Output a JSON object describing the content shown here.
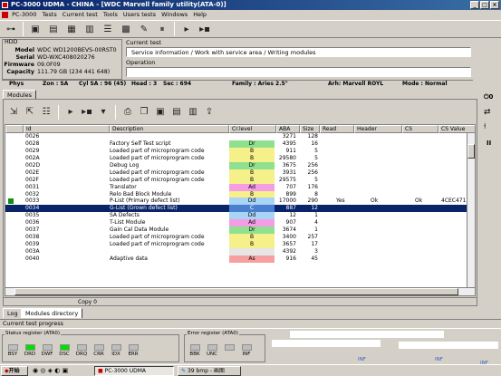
{
  "window": {
    "title": "PC-3000 UDMA - CHINA - [WDC Marvell family utility(ATA-0)]"
  },
  "menu": [
    "PC-3000",
    "Tests",
    "Current test",
    "Tools",
    "Users tests",
    "Windows",
    "Help"
  ],
  "hdd": {
    "section_label": "HDD",
    "model_label": "Model",
    "model": "WDC WD1200BEVS-00RST0",
    "serial_label": "Serial",
    "serial": "WD-WXC408020276",
    "firmware_label": "Firmware",
    "firmware": "09.0F09",
    "capacity_label": "Capacity",
    "capacity": "111.79 GB (234 441 648)"
  },
  "current_test": {
    "label": "Current test",
    "value": "Service information / Work with service area / Writing modules",
    "operation_label": "Operation",
    "operation": ""
  },
  "info": {
    "phys": "Phys",
    "zone": "Zon : SA",
    "cyl": "Cyl SA : 96 (45)",
    "head": "Head : 3",
    "sec": "Sec : 694",
    "family": "Family : Aries 2.5\"",
    "arh": "Arh: Marvell ROYL",
    "mode": "Mode : Normal"
  },
  "top_tab": "Modules",
  "grid": {
    "headers": [
      "Id",
      "Description",
      "Cr.level",
      "ABA",
      "Size",
      "Read",
      "Header",
      "CS",
      "CS Value"
    ],
    "rows": [
      {
        "id": "0026",
        "desc": "",
        "lvl": "",
        "color": "#ffffff",
        "aba": "3271",
        "size": "128",
        "read": "",
        "header": "",
        "cs": "",
        "csv": ""
      },
      {
        "id": "0028",
        "desc": "Factory Self Test script",
        "lvl": "Dr",
        "color": "#8fe08f",
        "aba": "4395",
        "size": "16",
        "read": "",
        "header": "",
        "cs": "",
        "csv": ""
      },
      {
        "id": "0029",
        "desc": "Loaded part of microprogram code",
        "lvl": "B",
        "color": "#f6f08a",
        "aba": "911",
        "size": "5",
        "read": "",
        "header": "",
        "cs": "",
        "csv": ""
      },
      {
        "id": "002A",
        "desc": "Loaded part of microprogram code",
        "lvl": "B",
        "color": "#f6f08a",
        "aba": "29580",
        "size": "5",
        "read": "",
        "header": "",
        "cs": "",
        "csv": ""
      },
      {
        "id": "002D",
        "desc": "Debug Log",
        "lvl": "Dr",
        "color": "#8fe08f",
        "aba": "3675",
        "size": "256",
        "read": "",
        "header": "",
        "cs": "",
        "csv": ""
      },
      {
        "id": "002E",
        "desc": "Loaded part of microprogram code",
        "lvl": "B",
        "color": "#f6f08a",
        "aba": "3931",
        "size": "256",
        "read": "",
        "header": "",
        "cs": "",
        "csv": ""
      },
      {
        "id": "002F",
        "desc": "Loaded part of microprogram code",
        "lvl": "B",
        "color": "#f6f08a",
        "aba": "29575",
        "size": "5",
        "read": "",
        "header": "",
        "cs": "",
        "csv": ""
      },
      {
        "id": "0031",
        "desc": "Translator",
        "lvl": "Ad",
        "color": "#f49ce4",
        "aba": "707",
        "size": "176",
        "read": "",
        "header": "",
        "cs": "",
        "csv": ""
      },
      {
        "id": "0032",
        "desc": "Relo Bad Block Module",
        "lvl": "B",
        "color": "#f6f08a",
        "aba": "899",
        "size": "8",
        "read": "",
        "header": "",
        "cs": "",
        "csv": ""
      },
      {
        "id": "0033",
        "desc": "P-List (Primary defect list)",
        "lvl": "Dd",
        "color": "#a9d4f5",
        "aba": "17000",
        "size": "290",
        "read": "Yes",
        "header": "Ok",
        "cs": "Ok",
        "csv": "4CEC4718"
      },
      {
        "id": "0034",
        "desc": "G-List (Grown defect list)",
        "lvl": "C",
        "color": "#b4e6ff",
        "aba": "887",
        "size": "12",
        "read": "",
        "header": "",
        "cs": "",
        "csv": "",
        "selected": true
      },
      {
        "id": "0035",
        "desc": "SA Defects",
        "lvl": "Dd",
        "color": "#a9d4f5",
        "aba": "12",
        "size": "1",
        "read": "",
        "header": "",
        "cs": "",
        "csv": ""
      },
      {
        "id": "0036",
        "desc": "T-List Module",
        "lvl": "Ad",
        "color": "#f49ce4",
        "aba": "907",
        "size": "4",
        "read": "",
        "header": "",
        "cs": "",
        "csv": ""
      },
      {
        "id": "0037",
        "desc": "Gain Cal Data Module",
        "lvl": "Dr",
        "color": "#8fe08f",
        "aba": "3674",
        "size": "1",
        "read": "",
        "header": "",
        "cs": "",
        "csv": ""
      },
      {
        "id": "0038",
        "desc": "Loaded part of microprogram code",
        "lvl": "B",
        "color": "#f6f08a",
        "aba": "3400",
        "size": "257",
        "read": "",
        "header": "",
        "cs": "",
        "csv": ""
      },
      {
        "id": "0039",
        "desc": "Loaded part of microprogram code",
        "lvl": "B",
        "color": "#f6f08a",
        "aba": "3657",
        "size": "17",
        "read": "",
        "header": "",
        "cs": "",
        "csv": ""
      },
      {
        "id": "003A",
        "desc": "",
        "lvl": "",
        "color": "#e6e6e6",
        "aba": "4392",
        "size": "3",
        "read": "",
        "header": "",
        "cs": "",
        "csv": ""
      },
      {
        "id": "0040",
        "desc": "Adaptive data",
        "lvl": "As",
        "color": "#f6a0a0",
        "aba": "916",
        "size": "45",
        "read": "",
        "header": "",
        "cs": "",
        "csv": ""
      }
    ]
  },
  "copy_status": "Copy 0",
  "bottom_tabs": [
    "Log",
    "Modules directory"
  ],
  "progress_label": "Current test progress",
  "status_register": {
    "label": "Status register (ATA0)",
    "leds": [
      {
        "name": "BSY",
        "on": false
      },
      {
        "name": "DRD",
        "on": true
      },
      {
        "name": "DWF",
        "on": false
      },
      {
        "name": "DSC",
        "on": true
      },
      {
        "name": "DRQ",
        "on": false
      },
      {
        "name": "CRR",
        "on": false
      },
      {
        "name": "IDX",
        "on": false
      },
      {
        "name": "ERR",
        "on": false
      }
    ]
  },
  "error_register": {
    "label": "Error register (ATA0)",
    "leds": [
      {
        "name": "BBK",
        "on": false
      },
      {
        "name": "UNC",
        "on": false
      },
      {
        "name": "",
        "on": false
      },
      {
        "name": "INF",
        "on": false
      }
    ]
  },
  "inf_labels": [
    "INF",
    "INF",
    "INF"
  ],
  "taskbar": {
    "start": "开始",
    "task1": "PC-3000 UDMA",
    "task2": "39 bmp - 画图"
  },
  "right_controls": [
    "0",
    "II"
  ]
}
